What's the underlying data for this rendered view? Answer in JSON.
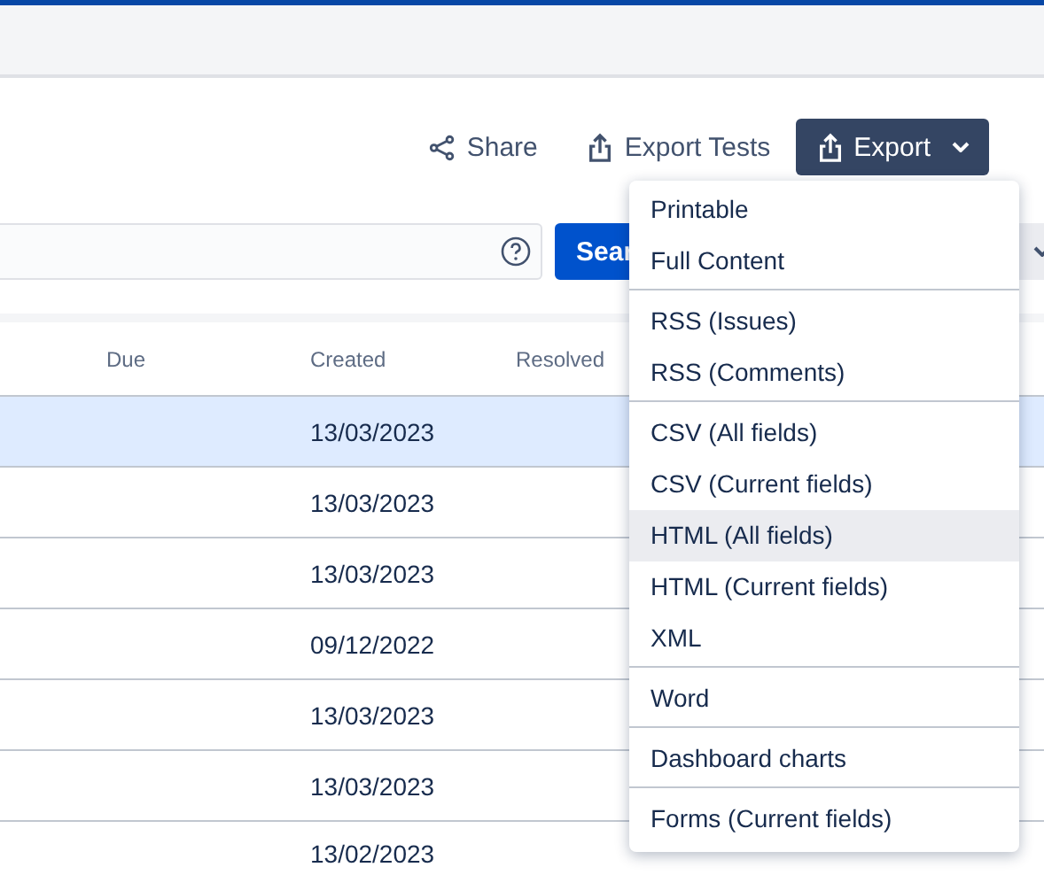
{
  "toolbar": {
    "share": "Share",
    "export_tests": "Export Tests",
    "export": "Export"
  },
  "search": {
    "button": "Sear"
  },
  "table": {
    "columns": [
      "Due",
      "Created",
      "Resolved"
    ],
    "rows": [
      {
        "due": "",
        "created": "13/03/2023",
        "selected": true
      },
      {
        "created": "13/03/2023",
        "selected": false
      },
      {
        "created": "13/03/2023",
        "selected": false
      },
      {
        "created": "09/12/2022",
        "selected": false
      },
      {
        "created": "13/03/2023",
        "selected": false
      },
      {
        "created": "13/03/2023",
        "selected": false
      },
      {
        "created": "13/02/2023",
        "selected": false
      }
    ]
  },
  "export_menu": {
    "groups": [
      [
        {
          "label": "Printable",
          "hovered": false
        },
        {
          "label": "Full Content",
          "hovered": false
        }
      ],
      [
        {
          "label": "RSS (Issues)",
          "hovered": false
        },
        {
          "label": "RSS (Comments)",
          "hovered": false
        }
      ],
      [
        {
          "label": "CSV (All fields)",
          "hovered": false
        },
        {
          "label": "CSV (Current fields)",
          "hovered": false
        },
        {
          "label": "HTML (All fields)",
          "hovered": true
        },
        {
          "label": "HTML (Current fields)",
          "hovered": false
        },
        {
          "label": "XML",
          "hovered": false
        }
      ],
      [
        {
          "label": "Word",
          "hovered": false
        }
      ],
      [
        {
          "label": "Dashboard charts",
          "hovered": false
        }
      ],
      [
        {
          "label": "Forms (Current fields)",
          "hovered": false
        }
      ]
    ]
  }
}
